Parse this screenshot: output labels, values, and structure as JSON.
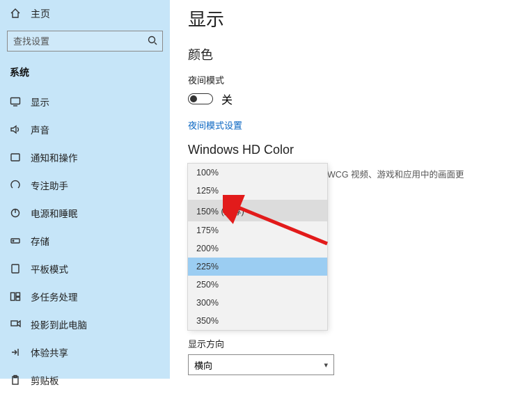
{
  "sidebar": {
    "home_label": "主页",
    "search_placeholder": "查找设置",
    "group_title": "系统",
    "items": [
      {
        "label": "显示"
      },
      {
        "label": "声音"
      },
      {
        "label": "通知和操作"
      },
      {
        "label": "专注助手"
      },
      {
        "label": "电源和睡眠"
      },
      {
        "label": "存储"
      },
      {
        "label": "平板模式"
      },
      {
        "label": "多任务处理"
      },
      {
        "label": "投影到此电脑"
      },
      {
        "label": "体验共享"
      },
      {
        "label": "剪贴板"
      }
    ]
  },
  "main": {
    "page_title": "显示",
    "color_heading": "颜色",
    "night_label": "夜间模式",
    "night_state": "关",
    "night_link": "夜间模式设置",
    "hd_heading": "Windows HD Color",
    "hd_desc": "在上面所选择的显示器上让 HDR 和 WCG 视频、游戏和应用中的画面更",
    "scale_dropdown": {
      "options": [
        "100%",
        "125%",
        "150% (推荐)",
        "175%",
        "200%",
        "225%",
        "250%",
        "300%",
        "350%"
      ],
      "hovered": "150% (推荐)",
      "selected": "225%"
    },
    "orientation_label": "显示方向",
    "orientation_value": "横向"
  }
}
